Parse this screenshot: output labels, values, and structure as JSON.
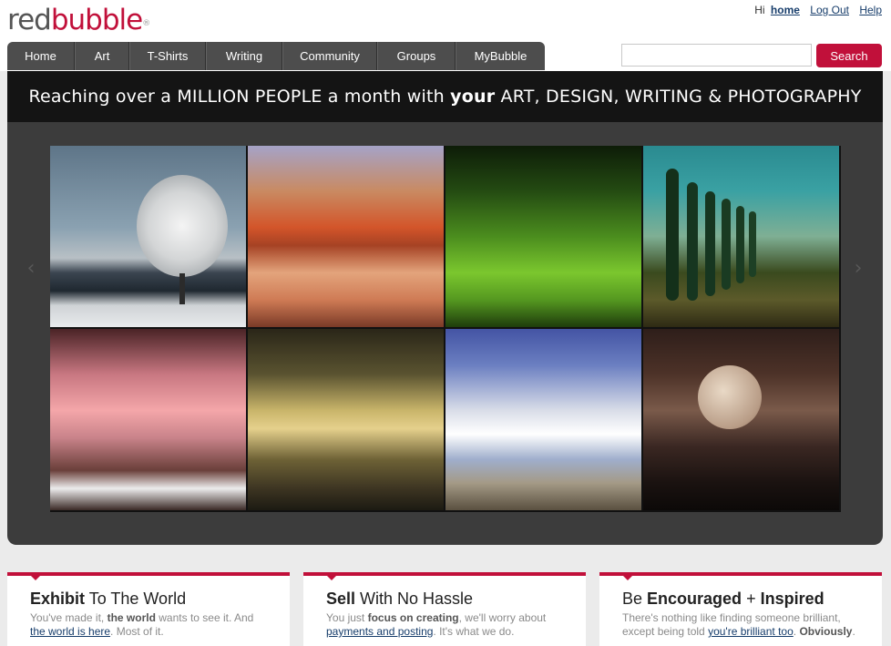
{
  "header": {
    "logo_part1": "red",
    "logo_part2": "bubble",
    "logo_mark": "®",
    "greeting": "Hi",
    "user_link": "home",
    "logout": "Log Out",
    "help": "Help"
  },
  "nav": {
    "items": [
      "Home",
      "Art",
      "T-Shirts",
      "Writing",
      "Community",
      "Groups",
      "MyBubble"
    ]
  },
  "search": {
    "value": "",
    "placeholder": "",
    "button_label": "Search"
  },
  "hero": {
    "banner_part1": "Reaching over a MILLION PEOPLE a month with ",
    "banner_bold": "your",
    "banner_part2": " ART, DESIGN, WRITING & PHOTOGRAPHY",
    "prev_icon": "chevron-left-icon",
    "next_icon": "chevron-right-icon",
    "prev_glyph": "‹",
    "next_glyph": "›"
  },
  "features": [
    {
      "title_bold": "Exhibit",
      "title_rest": " To The World",
      "line1_pre": "You've made it, ",
      "line1_bold": "the world",
      "line1_post": " wants to see it. And",
      "link": "the world is here",
      "line2_post": ". Most of it."
    },
    {
      "title_bold": "Sell",
      "title_rest": " With No Hassle",
      "line1_pre": "You just ",
      "line1_bold": "focus on creating",
      "line1_post": ", we'll worry about",
      "link": "payments and posting",
      "line2_post": ". It's what we do."
    },
    {
      "title_pre": "Be ",
      "title_bold": "Encouraged",
      "title_rest": " + ",
      "title_bold2": "Inspired",
      "line1": "There's nothing like finding someone brilliant,",
      "line2_pre": "except being told ",
      "link": "you're brilliant too",
      "line2_mid": ". ",
      "line2_bold": "Obviously",
      "line2_post": "."
    }
  ],
  "colors": {
    "brand_red": "#c1103a",
    "nav_bg": "#4d4d4d",
    "hero_bg": "#3c3c3c",
    "link": "#173d6b"
  }
}
